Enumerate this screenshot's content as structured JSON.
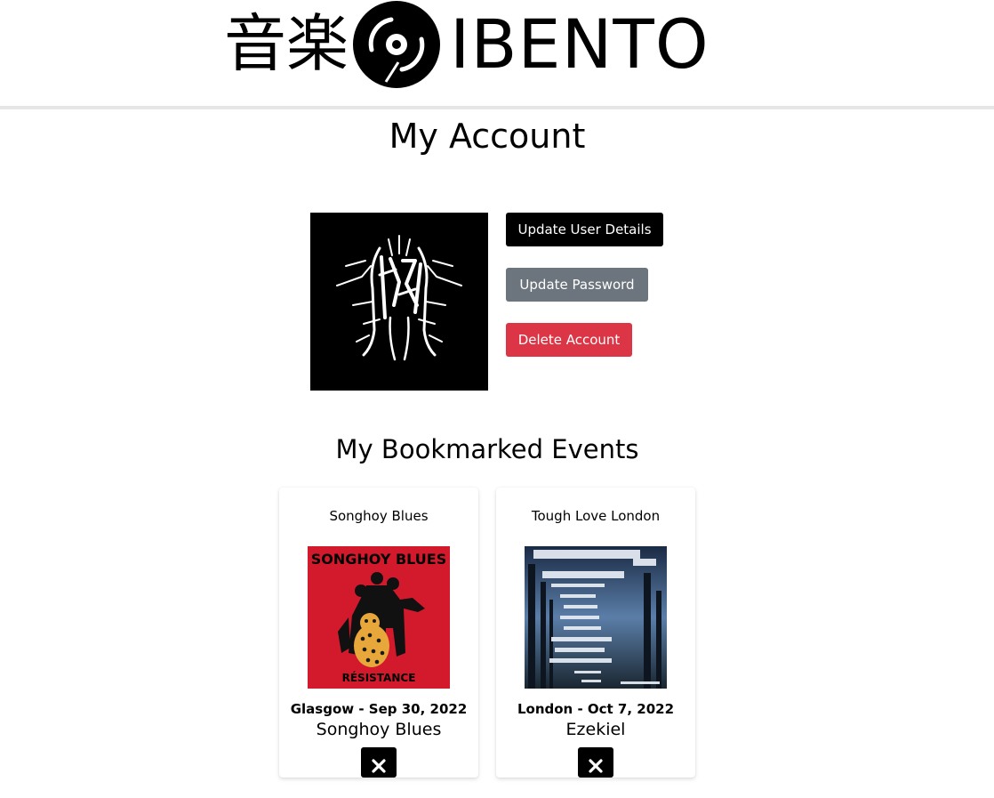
{
  "header": {
    "logo_kanji": "音楽",
    "logo_text": "IBENTO",
    "logo_icon": "vinyl-record-icon"
  },
  "page": {
    "title": "My Account"
  },
  "account": {
    "avatar_icon": "profile-artwork",
    "update_details_label": "Update User Details",
    "update_password_label": "Update Password",
    "delete_account_label": "Delete Account",
    "colors": {
      "primary": "#000000",
      "secondary": "#6c757d",
      "danger": "#dc3545"
    }
  },
  "bookmarks": {
    "title": "My Bookmarked Events",
    "events": [
      {
        "name": "Songhoy Blues",
        "poster_title": "SONGHOY BLUES",
        "poster_subtitle": "RÉSISTANCE",
        "meta": "Glasgow - Sep 30, 2022",
        "artist": "Songhoy Blues",
        "remove_icon": "close-icon"
      },
      {
        "name": "Tough Love London",
        "meta": "London - Oct 7, 2022",
        "artist": "Ezekiel",
        "remove_icon": "close-icon"
      }
    ]
  }
}
